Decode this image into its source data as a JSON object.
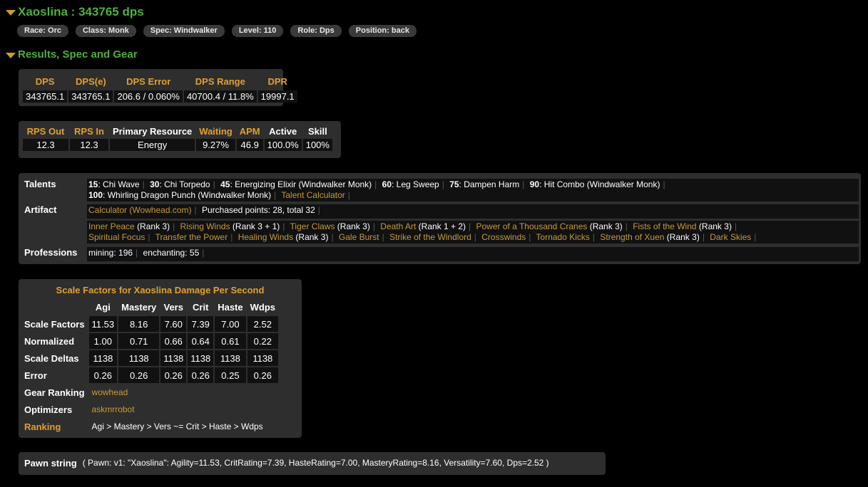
{
  "player": {
    "heading": "Xaoslina : 343765 dps",
    "chips": [
      "Race: Orc",
      "Class: Monk",
      "Spec: Windwalker",
      "Level: 110",
      "Role: Dps",
      "Position: back"
    ]
  },
  "section_title": "Results, Spec and Gear",
  "dps_table": {
    "headers": [
      "DPS",
      "DPS(e)",
      "DPS Error",
      "DPS Range",
      "DPR"
    ],
    "values": [
      "343765.1",
      "343765.1",
      "206.6 / 0.060%",
      "40700.4 / 11.8%",
      "19997.1"
    ]
  },
  "rps_table": {
    "headers": [
      "RPS Out",
      "RPS In",
      "Primary Resource",
      "Waiting",
      "APM",
      "Active",
      "Skill"
    ],
    "values": [
      "12.3",
      "12.3",
      "Energy",
      "9.27%",
      "46.9",
      "100.0%",
      "100%"
    ]
  },
  "talents": {
    "label": "Talents",
    "items": [
      {
        "level": "15",
        "name": "Chi Wave"
      },
      {
        "level": "30",
        "name": "Chi Torpedo"
      },
      {
        "level": "45",
        "name": "Energizing Elixir (Windwalker Monk)"
      },
      {
        "level": "60",
        "name": "Leg Sweep"
      },
      {
        "level": "75",
        "name": "Dampen Harm"
      },
      {
        "level": "90",
        "name": "Hit Combo (Windwalker Monk)"
      },
      {
        "level": "100",
        "name": "Whirling Dragon Punch (Windwalker Monk)"
      }
    ],
    "calculator_link": "Talent Calculator"
  },
  "artifact": {
    "label": "Artifact",
    "calculator_link": "Calculator (Wowhead.com)",
    "purchased": "Purchased points: 28, total 32",
    "traits": [
      {
        "name": "Inner Peace",
        "rank": "(Rank 3)"
      },
      {
        "name": "Rising Winds",
        "rank": "(Rank 3 + 1)"
      },
      {
        "name": "Tiger Claws",
        "rank": "(Rank 3)"
      },
      {
        "name": "Death Art",
        "rank": "(Rank 1 + 2)"
      },
      {
        "name": "Power of a Thousand Cranes",
        "rank": "(Rank 3)"
      },
      {
        "name": "Fists of the Wind",
        "rank": "(Rank 3)"
      },
      {
        "name": "Spiritual Focus",
        "rank": ""
      },
      {
        "name": "Transfer the Power",
        "rank": ""
      },
      {
        "name": "Healing Winds",
        "rank": "(Rank 3)"
      },
      {
        "name": "Gale Burst",
        "rank": ""
      },
      {
        "name": "Strike of the Windlord",
        "rank": ""
      },
      {
        "name": "Crosswinds",
        "rank": ""
      },
      {
        "name": "Tornado Kicks",
        "rank": ""
      },
      {
        "name": "Strength of Xuen",
        "rank": "(Rank 3)"
      },
      {
        "name": "Dark Skies",
        "rank": ""
      }
    ]
  },
  "professions": {
    "label": "Professions",
    "items": [
      "mining: 196",
      "enchanting: 55"
    ]
  },
  "scale_factors": {
    "title": "Scale Factors for Xaoslina Damage Per Second",
    "columns": [
      "Agi",
      "Mastery",
      "Vers",
      "Crit",
      "Haste",
      "Wdps"
    ],
    "rows": [
      {
        "label": "Scale Factors",
        "values": [
          "11.53",
          "8.16",
          "7.60",
          "7.39",
          "7.00",
          "2.52"
        ]
      },
      {
        "label": "Normalized",
        "values": [
          "1.00",
          "0.71",
          "0.66",
          "0.64",
          "0.61",
          "0.22"
        ]
      },
      {
        "label": "Scale Deltas",
        "values": [
          "1138",
          "1138",
          "1138",
          "1138",
          "1138",
          "1138"
        ]
      },
      {
        "label": "Error",
        "values": [
          "0.26",
          "0.26",
          "0.26",
          "0.26",
          "0.25",
          "0.26"
        ]
      }
    ],
    "gear_ranking": {
      "label": "Gear Ranking",
      "link": "wowhead"
    },
    "optimizers": {
      "label": "Optimizers",
      "link": "askmrrobot"
    },
    "ranking": {
      "label": "Ranking",
      "value": "Agi > Mastery > Vers ~= Crit > Haste > Wdps"
    }
  },
  "pawn": {
    "label": "Pawn string",
    "value": "( Pawn: v1: \"Xaoslina\": Agility=11.53, CritRating=7.39, HasteRating=7.00, MasteryRating=8.16, Versatility=7.60, Dps=2.52 )"
  }
}
